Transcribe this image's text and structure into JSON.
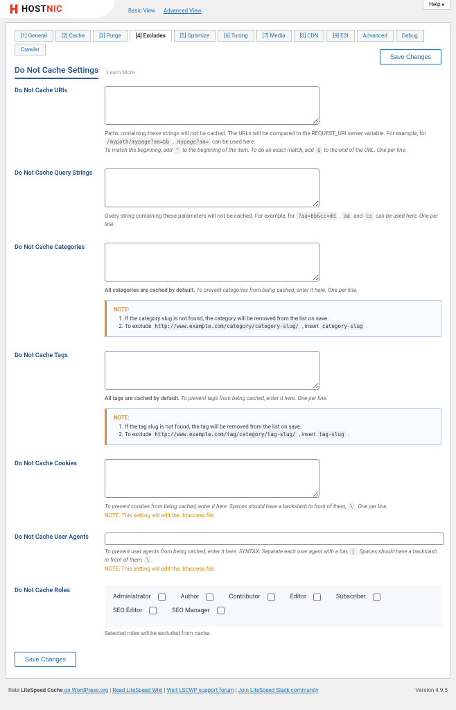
{
  "header": {
    "logo_left": "HOST",
    "logo_right": "NIC",
    "views": {
      "basic": "Basic View",
      "advanced": "Advanced View"
    },
    "help": "Help"
  },
  "tabs": [
    "[1] General",
    "[2] Cache",
    "[3] Purge",
    "[4] Excludes",
    "[5] Optimize",
    "[6] Tuning",
    "[7] Media",
    "[8] CDN",
    "[9] ESI",
    "Advanced",
    "Debug",
    "Crawler"
  ],
  "active_tab": 3,
  "page": {
    "title": "Do Not Cache Settings",
    "learn_more": "Learn More",
    "save": "Save Changes"
  },
  "rows": {
    "uris": {
      "label": "Do Not Cache URIs",
      "help1": "Paths containing these strings will not be cached. The URLs will be compared to the REQUEST_URI server variable. For example, for ",
      "code1": "/mypath/mypage?aa=bb",
      "help1b": " , ",
      "code1b": "mypage?aa=",
      "help1c": " can be used here.",
      "help2a": "To match the beginning, add ",
      "code2a": "^",
      "help2b": " to the beginning of the item. To do an exact match, add ",
      "code2b": "$",
      "help2c": " to the end of the URL. One per line."
    },
    "qs": {
      "label": "Do Not Cache Query Strings",
      "help": "Query string containing these parameters will not be cached. For example, for ",
      "code1": "?aa=bb&cc=dd",
      "help_sep": " , ",
      "code2": "aa",
      "help_and": " and ",
      "code3": "cc",
      "help_end": " can be used here. One per line."
    },
    "cats": {
      "label": "Do Not Cache Categories",
      "help_bold": "All categories are cached by default.",
      "help_rest": " To prevent categories from being cached, enter it here. One per line.",
      "note_label": "NOTE:",
      "note_li1": "If the category slug is not found, the category will be removed from the list on save.",
      "note_li2a": "To exclude ",
      "note_code": "http://www.example.com/category/category-slug/",
      "note_li2b": " , insert ",
      "note_code2": "category-slug",
      "note_li2c": " ."
    },
    "tags": {
      "label": "Do Not Cache Tags",
      "help_bold": "All tags are cached by default.",
      "help_rest": " To prevent tags from being cached, enter it here. One per line.",
      "note_label": "NOTE:",
      "note_li1": "If the tag slug is not found, the tag will be removed from the list on save.",
      "note_li2a": "To exclude ",
      "note_code": "http://www.example.com/tag/category/tag-slug/",
      "note_li2b": " , insert ",
      "note_code2": "tag-slug",
      "note_li2c": " ."
    },
    "cookies": {
      "label": "Do Not Cache Cookies",
      "help": "To prevent cookies from being cached, enter it here. Spaces should have a backslash in front of them, ",
      "code": "\\",
      "help_end": ". One per line.",
      "warn": "NOTE: This setting will edit the .htaccess file."
    },
    "ua": {
      "label": "Do Not Cache User Agents",
      "help": "To prevent user agents from being cached, enter it here. SYNTAX: Separate each user agent with a bar, ",
      "code1": "|",
      "help_mid": ". Spaces should have a backslash in front of them, ",
      "code2": "\\",
      "help_end": ".",
      "warn": "NOTE: This setting will edit the .htaccess file."
    },
    "roles": {
      "label": "Do Not Cache Roles",
      "items": [
        "Administrator",
        "Author",
        "Contributor",
        "Editor",
        "Subscriber",
        "SEO Editor",
        "SEO Manager"
      ],
      "help": "Selected roles will be excluded from cache."
    }
  },
  "footer": {
    "left_pre": "Rate ",
    "left_bold": "LiteSpeed Cache",
    "links": [
      " on WordPress.org",
      "Read LiteSpeed Wiki",
      "Visit LSCWP support forum",
      "Join LiteSpeed Slack community"
    ],
    "version": "Version 4.9.5"
  }
}
